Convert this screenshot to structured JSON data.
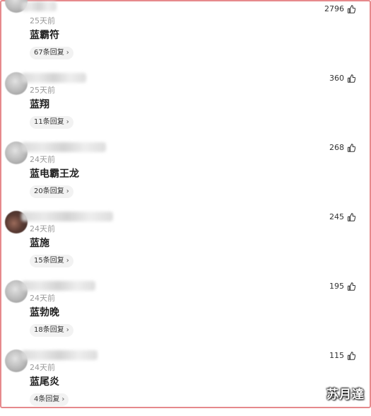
{
  "comments": [
    {
      "time": "25天前",
      "text": "蓝霸符",
      "replies": "67条回复",
      "likes": "2796"
    },
    {
      "time": "25天前",
      "text": "蓝翔",
      "replies": "11条回复",
      "likes": "360"
    },
    {
      "time": "24天前",
      "text": "蓝电霸王龙",
      "replies": "20条回复",
      "likes": "268"
    },
    {
      "time": "24天前",
      "text": "蓝施",
      "replies": "15条回复",
      "likes": "245"
    },
    {
      "time": "24天前",
      "text": "蓝勃晚",
      "replies": "18条回复",
      "likes": "195"
    },
    {
      "time": "24天前",
      "text": "蓝尾炎",
      "replies": "4条回复",
      "likes": "115"
    }
  ],
  "chevron": "›",
  "watermark": "苏月達"
}
